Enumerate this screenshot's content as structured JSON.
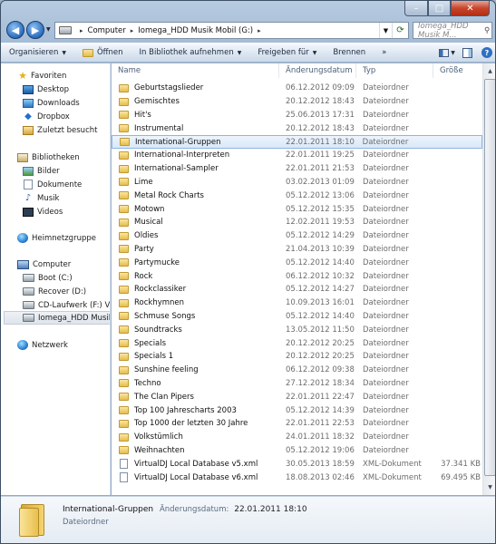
{
  "window_controls": {
    "min": "–",
    "max": "□",
    "close": "✕"
  },
  "address": {
    "crumbs": [
      "Computer",
      "Iomega_HDD Musik Mobil (G:)"
    ],
    "search_placeholder": "Iomega_HDD Musik M..."
  },
  "toolbar": {
    "organize": "Organisieren",
    "open": "Öffnen",
    "library": "In Bibliothek aufnehmen",
    "share": "Freigeben für",
    "burn": "Brennen",
    "more": "»",
    "help": "?"
  },
  "nav": {
    "favorites": "Favoriten",
    "desktop": "Desktop",
    "downloads": "Downloads",
    "dropbox": "Dropbox",
    "recent": "Zuletzt besucht",
    "libraries": "Bibliotheken",
    "pictures": "Bilder",
    "documents": "Dokumente",
    "music": "Musik",
    "videos": "Videos",
    "homegroup": "Heimnetzgruppe",
    "computer": "Computer",
    "boot": "Boot (C:)",
    "recover": "Recover (D:)",
    "cddrive": "CD-Laufwerk (F:) Vir",
    "iomega": "Iomega_HDD Musik",
    "network": "Netzwerk"
  },
  "columns": {
    "name": "Name",
    "date": "Änderungsdatum",
    "type": "Typ",
    "size": "Größe"
  },
  "files": [
    {
      "name": "Geburtstagslieder",
      "date": "06.12.2012 09:09",
      "type": "Dateiordner",
      "size": "",
      "kind": "folder"
    },
    {
      "name": "Gemischtes",
      "date": "20.12.2012 18:43",
      "type": "Dateiordner",
      "size": "",
      "kind": "folder"
    },
    {
      "name": "Hit's",
      "date": "25.06.2013 17:31",
      "type": "Dateiordner",
      "size": "",
      "kind": "folder"
    },
    {
      "name": "Instrumental",
      "date": "20.12.2012 18:43",
      "type": "Dateiordner",
      "size": "",
      "kind": "folder"
    },
    {
      "name": "International-Gruppen",
      "date": "22.01.2011 18:10",
      "type": "Dateiordner",
      "size": "",
      "kind": "folder",
      "selected": true
    },
    {
      "name": "International-Interpreten",
      "date": "22.01.2011 19:25",
      "type": "Dateiordner",
      "size": "",
      "kind": "folder"
    },
    {
      "name": "International-Sampler",
      "date": "22.01.2011 21:53",
      "type": "Dateiordner",
      "size": "",
      "kind": "folder"
    },
    {
      "name": "Lime",
      "date": "03.02.2013 01:09",
      "type": "Dateiordner",
      "size": "",
      "kind": "folder"
    },
    {
      "name": "Metal Rock Charts",
      "date": "05.12.2012 13:06",
      "type": "Dateiordner",
      "size": "",
      "kind": "folder"
    },
    {
      "name": "Motown",
      "date": "05.12.2012 15:35",
      "type": "Dateiordner",
      "size": "",
      "kind": "folder"
    },
    {
      "name": "Musical",
      "date": "12.02.2011 19:53",
      "type": "Dateiordner",
      "size": "",
      "kind": "folder"
    },
    {
      "name": "Oldies",
      "date": "05.12.2012 14:29",
      "type": "Dateiordner",
      "size": "",
      "kind": "folder"
    },
    {
      "name": "Party",
      "date": "21.04.2013 10:39",
      "type": "Dateiordner",
      "size": "",
      "kind": "folder"
    },
    {
      "name": "Partymucke",
      "date": "05.12.2012 14:40",
      "type": "Dateiordner",
      "size": "",
      "kind": "folder"
    },
    {
      "name": "Rock",
      "date": "06.12.2012 10:32",
      "type": "Dateiordner",
      "size": "",
      "kind": "folder"
    },
    {
      "name": "Rockclassiker",
      "date": "05.12.2012 14:27",
      "type": "Dateiordner",
      "size": "",
      "kind": "folder"
    },
    {
      "name": "Rockhymnen",
      "date": "10.09.2013 16:01",
      "type": "Dateiordner",
      "size": "",
      "kind": "folder"
    },
    {
      "name": "Schmuse Songs",
      "date": "05.12.2012 14:40",
      "type": "Dateiordner",
      "size": "",
      "kind": "folder"
    },
    {
      "name": "Soundtracks",
      "date": "13.05.2012 11:50",
      "type": "Dateiordner",
      "size": "",
      "kind": "folder"
    },
    {
      "name": "Specials",
      "date": "20.12.2012 20:25",
      "type": "Dateiordner",
      "size": "",
      "kind": "folder"
    },
    {
      "name": "Specials 1",
      "date": "20.12.2012 20:25",
      "type": "Dateiordner",
      "size": "",
      "kind": "folder"
    },
    {
      "name": "Sunshine feeling",
      "date": "06.12.2012 09:38",
      "type": "Dateiordner",
      "size": "",
      "kind": "folder"
    },
    {
      "name": "Techno",
      "date": "27.12.2012 18:34",
      "type": "Dateiordner",
      "size": "",
      "kind": "folder"
    },
    {
      "name": "The Clan Pipers",
      "date": "22.01.2011 22:47",
      "type": "Dateiordner",
      "size": "",
      "kind": "folder"
    },
    {
      "name": "Top 100 Jahrescharts 2003",
      "date": "05.12.2012 14:39",
      "type": "Dateiordner",
      "size": "",
      "kind": "folder"
    },
    {
      "name": "Top 1000 der letzten 30 Jahre",
      "date": "22.01.2011 22:53",
      "type": "Dateiordner",
      "size": "",
      "kind": "folder"
    },
    {
      "name": "Volkstümlich",
      "date": "24.01.2011 18:32",
      "type": "Dateiordner",
      "size": "",
      "kind": "folder"
    },
    {
      "name": "Weihnachten",
      "date": "05.12.2012 19:06",
      "type": "Dateiordner",
      "size": "",
      "kind": "folder"
    },
    {
      "name": "VirtualDJ Local Database v5.xml",
      "date": "30.05.2013 18:59",
      "type": "XML-Dokument",
      "size": "37.341 KB",
      "kind": "xml"
    },
    {
      "name": "VirtualDJ Local Database v6.xml",
      "date": "18.08.2013 02:46",
      "type": "XML-Dokument",
      "size": "69.495 KB",
      "kind": "xml"
    }
  ],
  "details": {
    "name": "International-Gruppen",
    "date_label": "Änderungsdatum:",
    "date_value": "22.01.2011 18:10",
    "type": "Dateiordner"
  }
}
